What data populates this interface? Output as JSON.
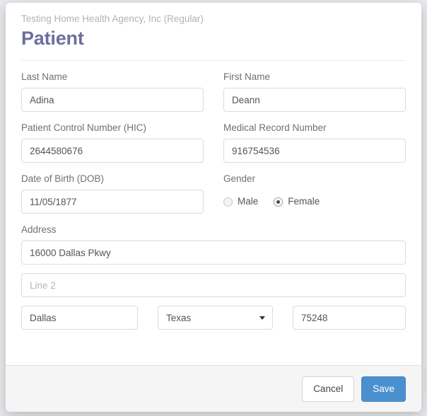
{
  "modal": {
    "subtitle": "Testing Home Health Agency, Inc (Regular)",
    "title": "Patient"
  },
  "form": {
    "last_name": {
      "label": "Last Name",
      "value": "Adina"
    },
    "first_name": {
      "label": "First Name",
      "value": "Deann"
    },
    "patient_control_number": {
      "label": "Patient Control Number (HIC)",
      "value": "2644580676"
    },
    "medical_record_number": {
      "label": "Medical Record Number",
      "value": "916754536"
    },
    "date_of_birth": {
      "label": "Date of Birth (DOB)",
      "value": "11/05/1877"
    },
    "gender": {
      "label": "Gender",
      "selected": "Female",
      "options": [
        {
          "label": "Male",
          "checked": false
        },
        {
          "label": "Female",
          "checked": true
        }
      ]
    },
    "address": {
      "label": "Address",
      "line1": "16000 Dallas Pkwy",
      "line2_value": "",
      "line2_placeholder": "Line 2",
      "city": "Dallas",
      "state": "Texas",
      "zip": "75248"
    }
  },
  "footer": {
    "cancel_label": "Cancel",
    "save_label": "Save"
  },
  "colors": {
    "title": "#6c6f9e",
    "primary_button": "#4a90cf",
    "footer_background": "#f5f5f5",
    "input_border": "#dcdcdc"
  }
}
